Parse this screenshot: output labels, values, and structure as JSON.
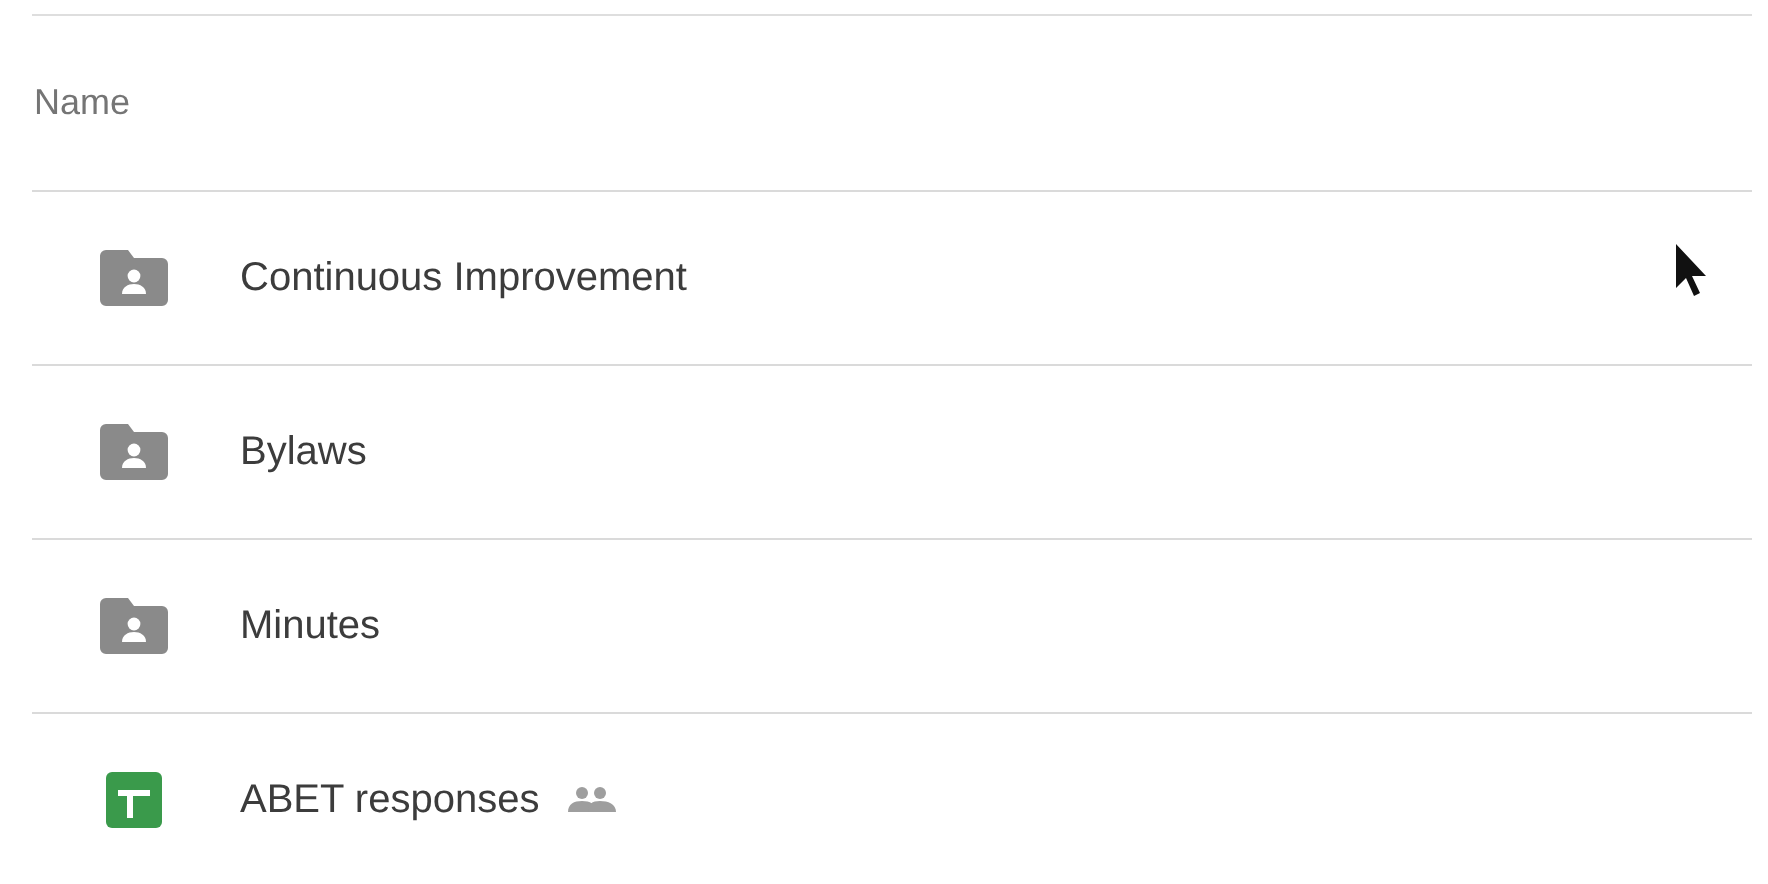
{
  "header": {
    "label": "Name"
  },
  "files": [
    {
      "kind": "shared-folder",
      "name": "Continuous Improvement",
      "shared": false
    },
    {
      "kind": "shared-folder",
      "name": "Bylaws",
      "shared": false
    },
    {
      "kind": "shared-folder",
      "name": "Minutes",
      "shared": false
    },
    {
      "kind": "sheet",
      "name": "ABET responses",
      "shared": true
    }
  ]
}
